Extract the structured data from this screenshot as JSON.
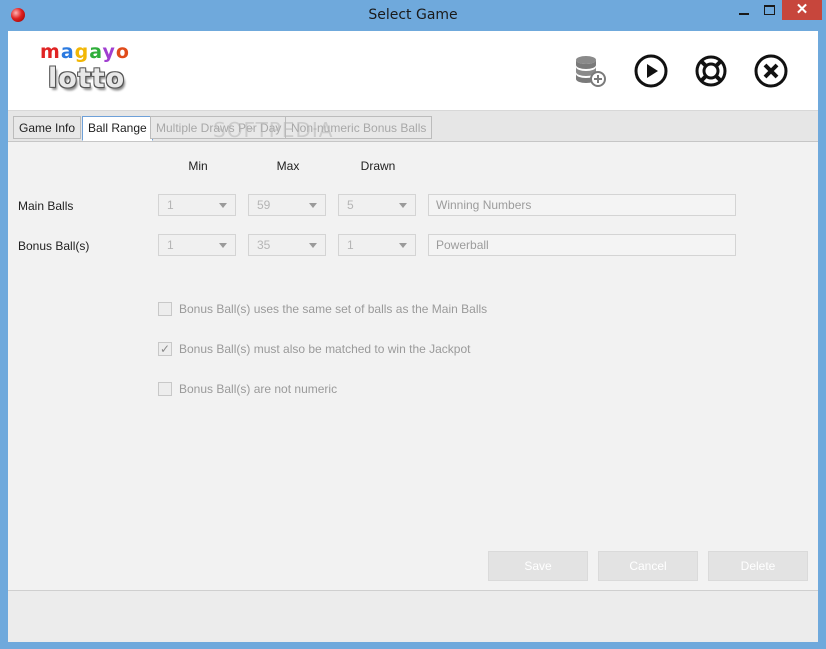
{
  "window": {
    "title": "Select Game"
  },
  "logo": {
    "top_text": "magayo",
    "bottom_text": "lotto",
    "top_colors": [
      "#e02424",
      "#2b7ae0",
      "#f2b705",
      "#2fae3a",
      "#a03fd0",
      "#e04b1a"
    ]
  },
  "toolbar": {
    "icons": [
      "database-add-icon",
      "play-icon",
      "lifebuoy-icon",
      "close-circle-icon"
    ]
  },
  "tabs": [
    {
      "label": "Game Info",
      "state": "normal"
    },
    {
      "label": "Ball Range",
      "state": "active"
    },
    {
      "label": "Multiple Draws Per Day",
      "state": "disabled"
    },
    {
      "label": "Non-numeric Bonus Balls",
      "state": "disabled"
    }
  ],
  "watermark": "SOFTPEDIA",
  "columns": {
    "min": "Min",
    "max": "Max",
    "drawn": "Drawn"
  },
  "rows": {
    "main": {
      "label": "Main Balls",
      "min": "1",
      "max": "59",
      "drawn": "5",
      "name": "Winning Numbers"
    },
    "bonus": {
      "label": "Bonus Ball(s)",
      "min": "1",
      "max": "35",
      "drawn": "1",
      "name": "Powerball"
    }
  },
  "options": [
    {
      "label": "Bonus Ball(s) uses the same set of balls as the Main Balls",
      "checked": false
    },
    {
      "label": "Bonus Ball(s) must also be matched to win the Jackpot",
      "checked": true
    },
    {
      "label": "Bonus Ball(s) are not numeric",
      "checked": false
    }
  ],
  "buttons": {
    "save": "Save",
    "cancel": "Cancel",
    "delete": "Delete"
  },
  "colors": {
    "title_bar": "#6fa9dc",
    "close_button": "#c7463c",
    "active_tab_border": "#6ea0d8"
  }
}
